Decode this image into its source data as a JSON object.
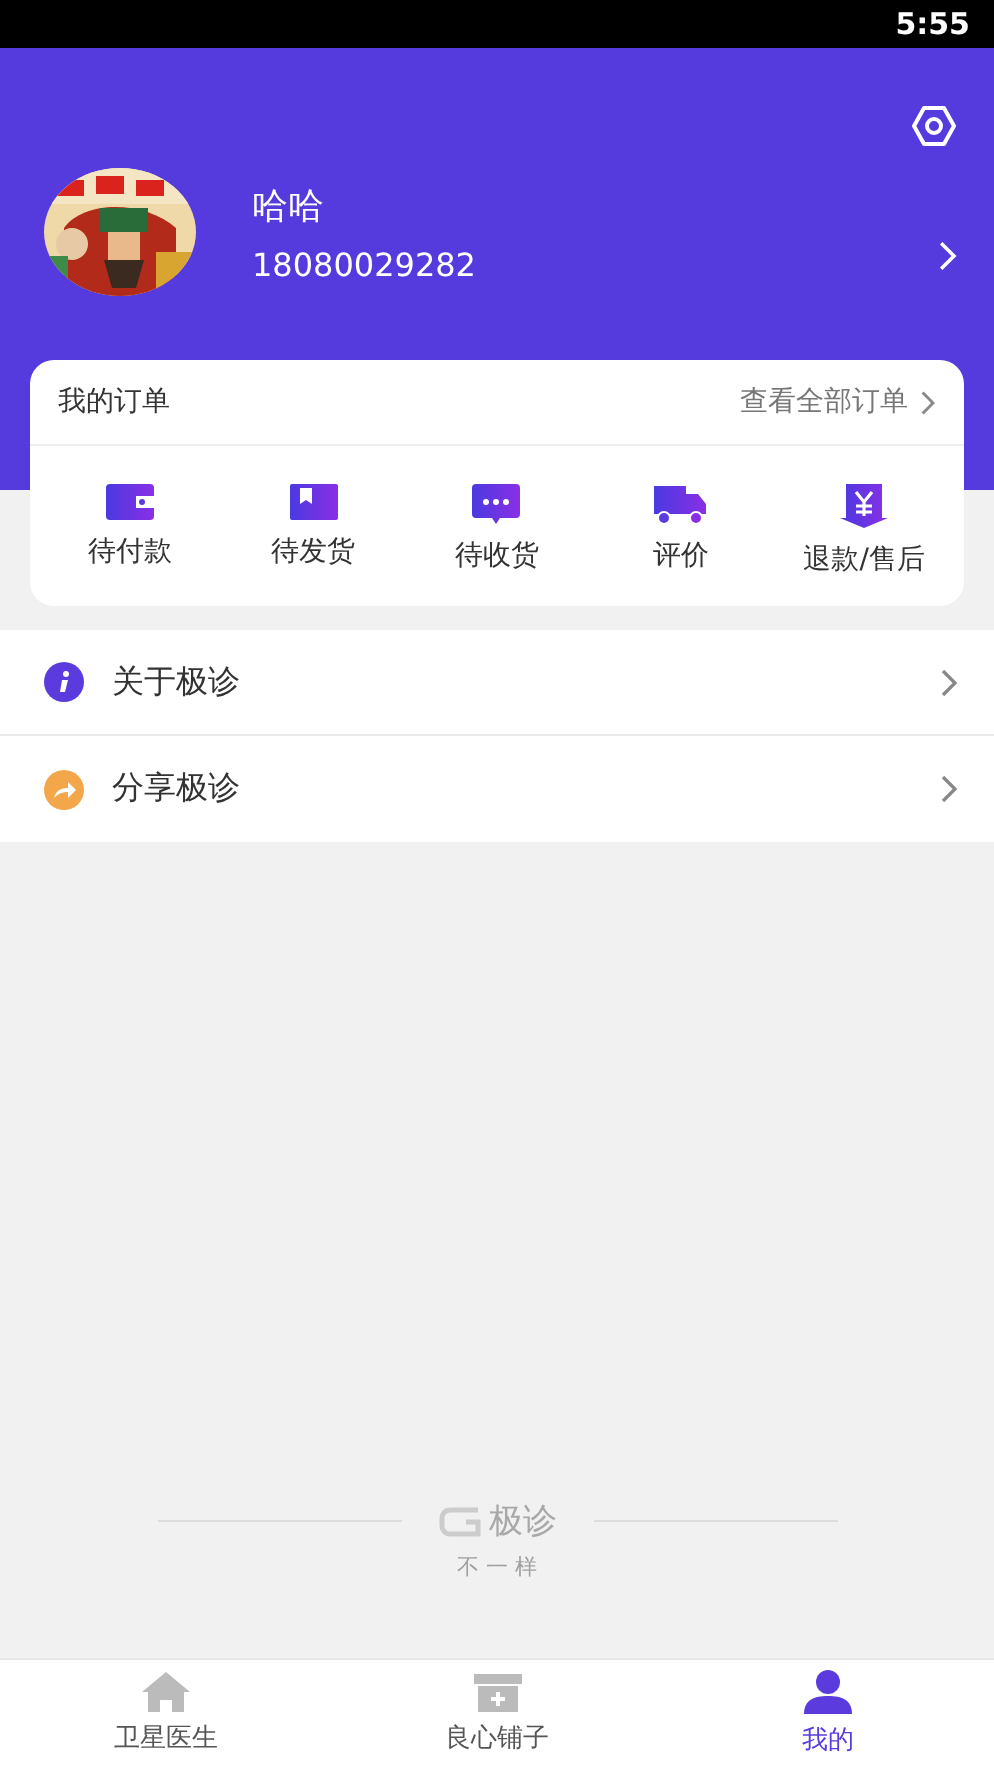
{
  "status_bar": {
    "time": "5:55"
  },
  "profile": {
    "name": "哈哈",
    "phone": "18080029282"
  },
  "orders": {
    "title": "我的订单",
    "view_all": "查看全部订单",
    "items": [
      {
        "kind": "wallet",
        "label": "待付款"
      },
      {
        "kind": "box",
        "label": "待发货"
      },
      {
        "kind": "chat",
        "label": "待收货"
      },
      {
        "kind": "truck",
        "label": "评价"
      },
      {
        "kind": "refund",
        "label": "退款/售后"
      }
    ]
  },
  "menu": [
    {
      "kind": "info",
      "label": "关于极诊",
      "color": "#5b3bdd"
    },
    {
      "kind": "share",
      "label": "分享极诊",
      "color": "#f4a64b"
    }
  ],
  "footer": {
    "brand": "极诊",
    "slogan": "不 一 样"
  },
  "tabs": [
    {
      "kind": "home",
      "label": "卫星医生",
      "selected": false
    },
    {
      "kind": "store",
      "label": "良心铺子",
      "selected": false
    },
    {
      "kind": "user",
      "label": "我的",
      "selected": true
    }
  ]
}
